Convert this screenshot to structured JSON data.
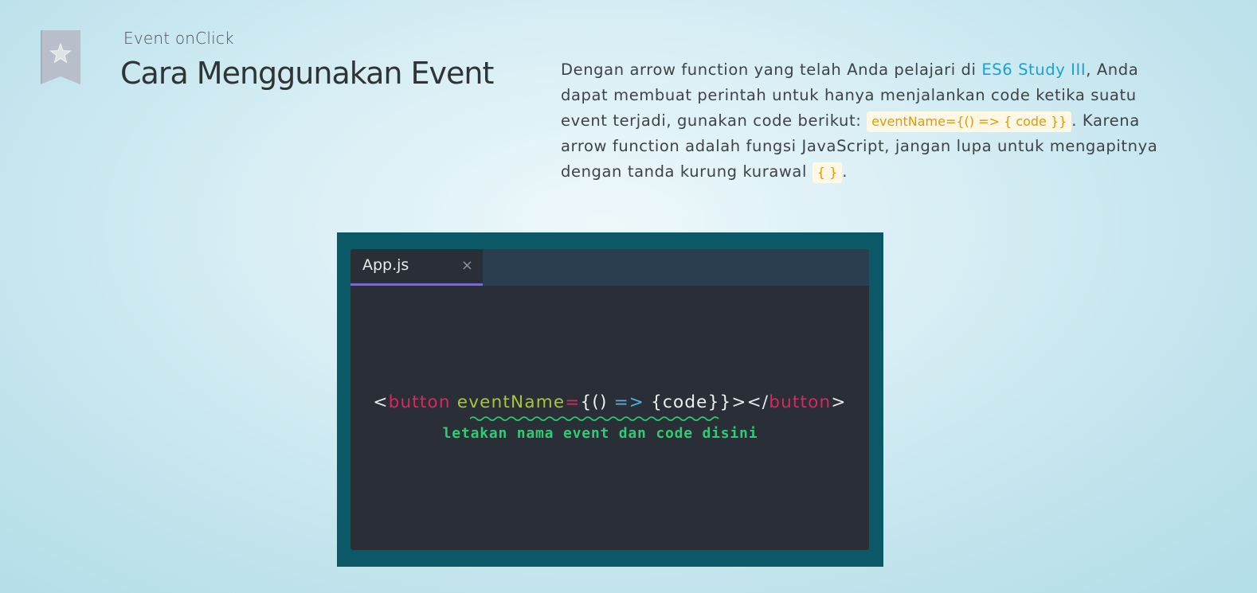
{
  "header": {
    "bookmark_icon": "star-bookmark-icon",
    "subtitle": "Event onClick",
    "title": "Cara Menggunakan Event"
  },
  "paragraph": {
    "text_1": "Dengan arrow function yang telah Anda pelajari di ",
    "link": "ES6 Study III",
    "text_2": ", Anda dapat membuat perintah untuk hanya menjalankan code ketika suatu event terjadi, gunakan code berikut: ",
    "code_1": "eventName={() => { code }}",
    "text_3": ". Karena arrow function adalah fungsi JavaScript, jangan lupa untuk mengapitnya dengan tanda kurung kurawal ",
    "code_2": "{ }",
    "text_4": "."
  },
  "editor": {
    "tab": {
      "label": "App.js",
      "close": "×"
    },
    "code": {
      "open_bracket": "<",
      "tag_open": "button",
      "space": " ",
      "attr": "eventName",
      "equals": "=",
      "brace_paren": "{()",
      "space2": " ",
      "arrow": "=>",
      "space3": " ",
      "body": "{code}}",
      "close_open": "></",
      "tag_close": "button",
      "end": ">"
    },
    "annotation": "letakan nama event dan code disini"
  },
  "colors": {
    "accent_link": "#1aa0d6",
    "code_chip_text": "#e09b00",
    "code_chip_bg": "#fff8e6",
    "editor_frame": "#0b5867",
    "editor_bg": "#2a2e36",
    "tab_bar": "#2b3e50",
    "tab_underline": "#7b6cc8",
    "tag": "#e0245e",
    "attr": "#a4c639",
    "arrow": "#4fb3e3",
    "annotation": "#2fcc71"
  }
}
